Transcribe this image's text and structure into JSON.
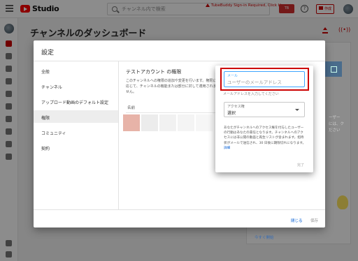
{
  "topbar": {
    "brand": "Studio",
    "search_placeholder": "チャンネル内で検索",
    "warning": "TubeBuddy Sign-in Required, Click Here",
    "tubebuddy_label": "TB",
    "help_symbol": "?",
    "create_label": "作成"
  },
  "page": {
    "title": "チャンネルのダッシュボード",
    "live_symbol": "((•))"
  },
  "settings_dialog": {
    "title": "設定",
    "nav": [
      {
        "label": "全般"
      },
      {
        "label": "チャンネル"
      },
      {
        "label": "アップロード動画のデフォルト設定"
      },
      {
        "label": "権限"
      },
      {
        "label": "コミュニティ"
      },
      {
        "label": "契約"
      }
    ],
    "active_index": 3,
    "panel_title": "テストアカウント の権限",
    "panel_desc": "このチャンネルへの権限の追加や変更を行います。権限に応じて、チャンネルの機能または部分に対して適用されません。",
    "column_name": "名前",
    "close_label": "閉じる",
    "save_label": "保存"
  },
  "invite_popup": {
    "email_label": "メール",
    "email_placeholder": "ユーザーのメールアドレス",
    "email_helper": "メールアドレスを入力してください",
    "access_label": "アクセス権",
    "access_value": "選択",
    "description": "あなたがチャンネルへのアクセス権を付与したユーザーの行動はあなたの責任となります。チャンネルへのアクセスには非公開の動画と再生リストが含まれます。招待状がメールで送信され、30 日後に期限切れになります。",
    "learn_more": "詳細",
    "done_label": "完了"
  },
  "background_fragments": {
    "f1": "ーザー",
    "f2": "には、ク",
    "f3": "ださい",
    "f4": "今すぐ開始"
  },
  "colors": {
    "accent_red": "#cc0000",
    "focus_blue": "#3ea6ff",
    "link_blue": "#065fd4"
  },
  "icons": [
    "menu-icon",
    "youtube-logo-icon",
    "search-icon",
    "warning-icon",
    "help-icon",
    "create-icon",
    "upload-icon",
    "live-icon",
    "chevron-down-icon"
  ]
}
